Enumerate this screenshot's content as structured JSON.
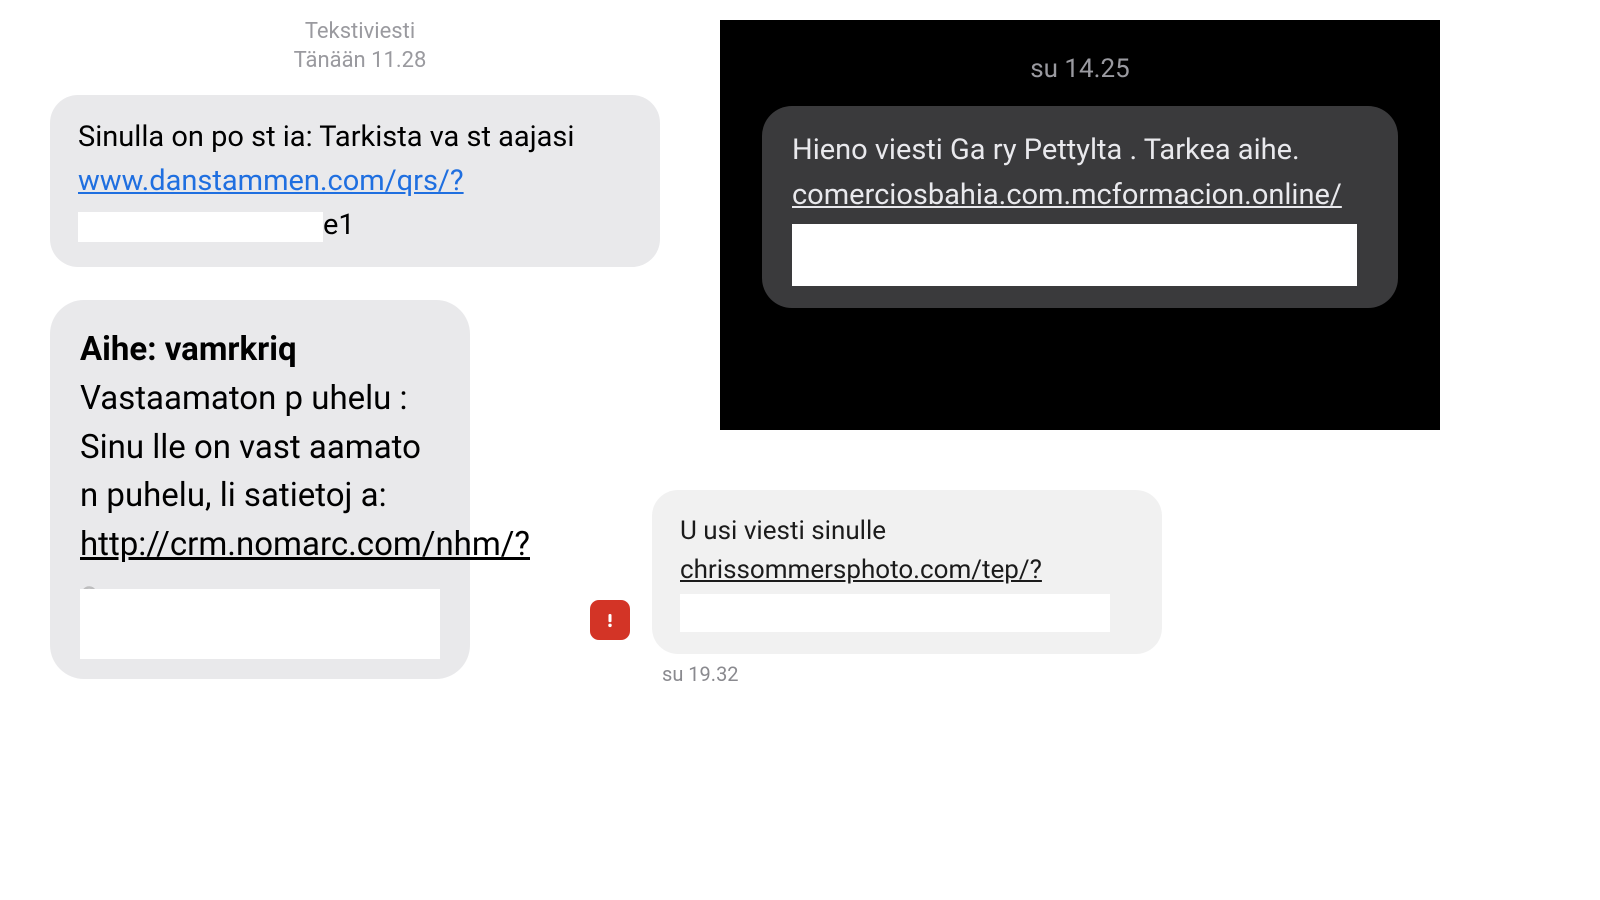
{
  "panel1": {
    "header_line1": "Tekstiviesti",
    "header_line2": "Tänään 11.28",
    "text_before_link": "Sinulla  on po st ia:  Tarkista va st aajasi  ",
    "link": "www.danstammen.com/qrs/?",
    "text_trail": "e1"
  },
  "panel2": {
    "subject_label": "Aihe: ",
    "subject_value": "vamrkriq",
    "body_before_link": "Vastaamaton  p uhelu : Sinu lle  on vast aamato n puhelu, li satietoj a:",
    "link": "http://crm.nomarc.com/nhm/?",
    "ghost_char": "c"
  },
  "panel3": {
    "timestamp": "su 14.25",
    "text_before_link": "Hieno viesti  Ga ry   Pettylta . Tarkea aihe.  ",
    "link": "comerciosbahia.com.mcformacion.online/"
  },
  "panel4": {
    "text_before_link": "U  usi viesti sinulle",
    "link": "chrissommersphoto.com/tep/?",
    "timestamp": "su 19.32"
  }
}
